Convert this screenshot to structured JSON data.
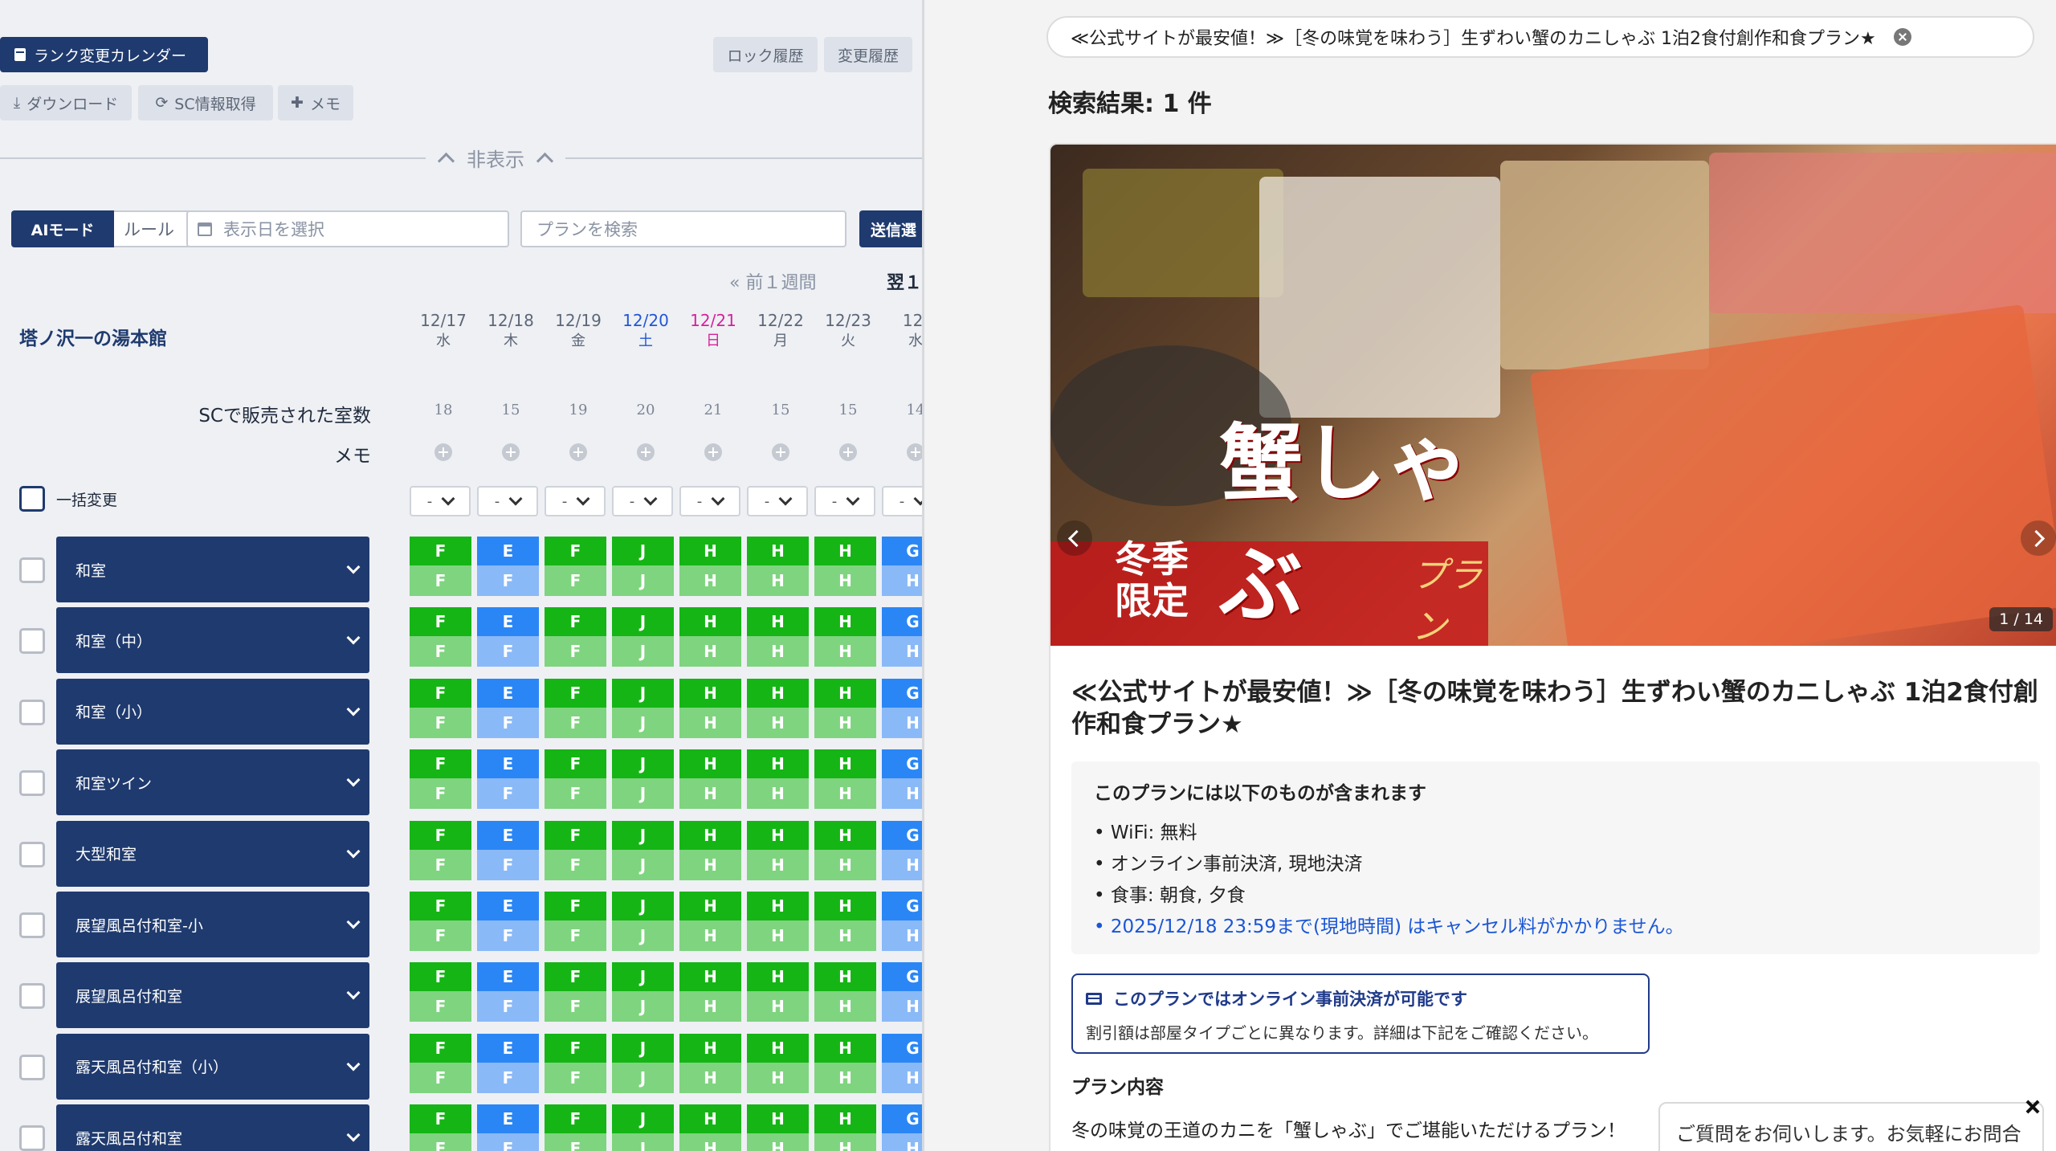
{
  "left": {
    "rank_calendar_label": "ランク変更カレンダー",
    "lock_history_label": "ロック履歴",
    "change_history_label": "変更履歴",
    "download_label": "ダウンロード",
    "sc_fetch_label": "SC情報取得",
    "memo_add_label": "メモ",
    "hide_label": "非表示",
    "ai_mode_label": "AIモード",
    "rule_label": "ルール",
    "date_placeholder": "表示日を選択",
    "plan_search_placeholder": "プランを検索",
    "send_label": "送信選",
    "prev_week_label": "前１週間",
    "next_week_label": "翌１",
    "hotel_name": "塔ノ沢一の湯本館",
    "dates": [
      {
        "date": "12/17",
        "dow": "水",
        "type": "weekday"
      },
      {
        "date": "12/18",
        "dow": "木",
        "type": "weekday"
      },
      {
        "date": "12/19",
        "dow": "金",
        "type": "weekday"
      },
      {
        "date": "12/20",
        "dow": "土",
        "type": "sat"
      },
      {
        "date": "12/21",
        "dow": "日",
        "type": "sun"
      },
      {
        "date": "12/22",
        "dow": "月",
        "type": "weekday"
      },
      {
        "date": "12/23",
        "dow": "火",
        "type": "weekday"
      },
      {
        "date": "12/",
        "dow": "水",
        "type": "weekday"
      }
    ],
    "sold_rooms_label": "SCで販売された室数",
    "sold_rooms": [
      "18",
      "15",
      "19",
      "20",
      "21",
      "15",
      "15",
      "14"
    ],
    "memo_label": "メモ",
    "bulk_change_label": "一括変更",
    "bulk_select_value": "-",
    "rooms": [
      {
        "name": "和室"
      },
      {
        "name": "和室（中）"
      },
      {
        "name": "和室（小）"
      },
      {
        "name": "和室ツイン"
      },
      {
        "name": "大型和室"
      },
      {
        "name": "展望風呂付和室-小"
      },
      {
        "name": "展望風呂付和室"
      },
      {
        "name": "露天風呂付和室（小）"
      },
      {
        "name": "露天風呂付和室"
      }
    ],
    "rank_columns": [
      {
        "top": "F",
        "bottom": "F",
        "color": "green"
      },
      {
        "top": "E",
        "bottom": "F",
        "color": "blue"
      },
      {
        "top": "F",
        "bottom": "F",
        "color": "green"
      },
      {
        "top": "J",
        "bottom": "J",
        "color": "green"
      },
      {
        "top": "H",
        "bottom": "H",
        "color": "green"
      },
      {
        "top": "H",
        "bottom": "H",
        "color": "green"
      },
      {
        "top": "H",
        "bottom": "H",
        "color": "green"
      },
      {
        "top": "G",
        "bottom": "H",
        "color": "blue"
      }
    ]
  },
  "right": {
    "search_chip": "≪公式サイトが最安値！≫［冬の味覚を味わう］生ずわい蟹のカニしゃぶ 1泊2食付創作和食プラン★",
    "results_label": "検索結果: 1 件",
    "banner_seasonal": "冬季限定",
    "banner_main": "蟹しゃぶ",
    "banner_sub": "プラン",
    "image_counter": "1 / 14",
    "plan_title": "≪公式サイトが最安値！≫［冬の味覚を味わう］生ずわい蟹のカニしゃぶ 1泊2食付創作和食プラン★",
    "includes_title": "このプランには以下のものが含まれます",
    "includes": [
      "WiFi: 無料",
      "オンライン事前決済, 現地決済",
      "食事: 朝食, 夕食"
    ],
    "cancel_note": "2025/12/18 23:59まで(現地時間) はキャンセル料がかかりません。",
    "payment_title": "このプランではオンライン事前決済が可能です",
    "payment_desc": "割引額は部屋タイプごとに異なります。詳細は下記をご確認ください。",
    "plan_content_label": "プラン内容",
    "plan_desc_line1": "冬の味覚の王道のカニを「蟹しゃぶ」でご堪能いただけるプラン！",
    "chat_text": "ご質問をお伺いします。お気軽にお問合せ"
  }
}
